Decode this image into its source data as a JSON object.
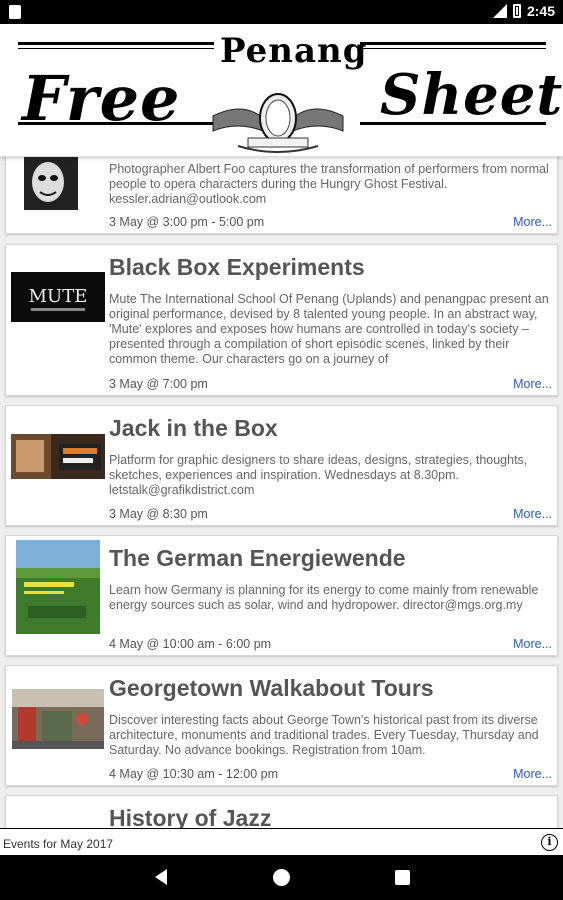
{
  "status_bar": {
    "time": "2:45"
  },
  "masthead": {
    "word_left": "Free",
    "word_center": "Penang",
    "word_right": "Sheet"
  },
  "events": [
    {
      "title": "",
      "description": "Photographer Albert Foo captures the transformation of performers from normal people to opera characters during the Hungry Ghost Festival. kessler.adrian@outlook.com",
      "date": "3 May @ 3:00 pm - 5:00 pm",
      "more": "More..."
    },
    {
      "title": "Black Box Experiments",
      "description": "Mute The International School Of Penang (Uplands) and penangpac present an original performance, devised by 8 talented young people. In an abstract way, 'Mute' explores and exposes how humans are controlled in today's society – presented through a compilation of short episodic scenes, linked by their common theme. Our characters go on a journey of",
      "date": "3 May @ 7:00 pm",
      "more": "More...",
      "thumb_text": "MUTE"
    },
    {
      "title": "Jack in the Box",
      "description": "Platform for graphic designers to share ideas, designs, strategies, thoughts, sketches, experiences and inspiration. Wednesdays at 8.30pm. letstalk@grafikdistrict.com",
      "date": "3 May @ 8:30 pm",
      "more": "More..."
    },
    {
      "title": "The German Energiewende",
      "description": "Learn how Germany is planning for its energy to come mainly from renewable energy sources such as solar, wind and hydropower. director@mgs.org.my",
      "date": "4 May @ 10:00 am - 6:00 pm",
      "more": "More..."
    },
    {
      "title": "Georgetown Walkabout Tours",
      "description": "Discover interesting facts about George Town's historical past from its diverse architecture, monuments and traditional trades. Every Tuesday, Thursday and Saturday. No advance bookings. Registration from 10am.",
      "date": "4 May @ 10:30 am - 12:00 pm",
      "more": "More..."
    },
    {
      "title": "History of Jazz"
    }
  ],
  "footer": {
    "text": "Events for May 2017",
    "info_icon": "i"
  },
  "colors": {
    "link": "#2b5ea8",
    "title": "#555555",
    "body": "#666666"
  }
}
